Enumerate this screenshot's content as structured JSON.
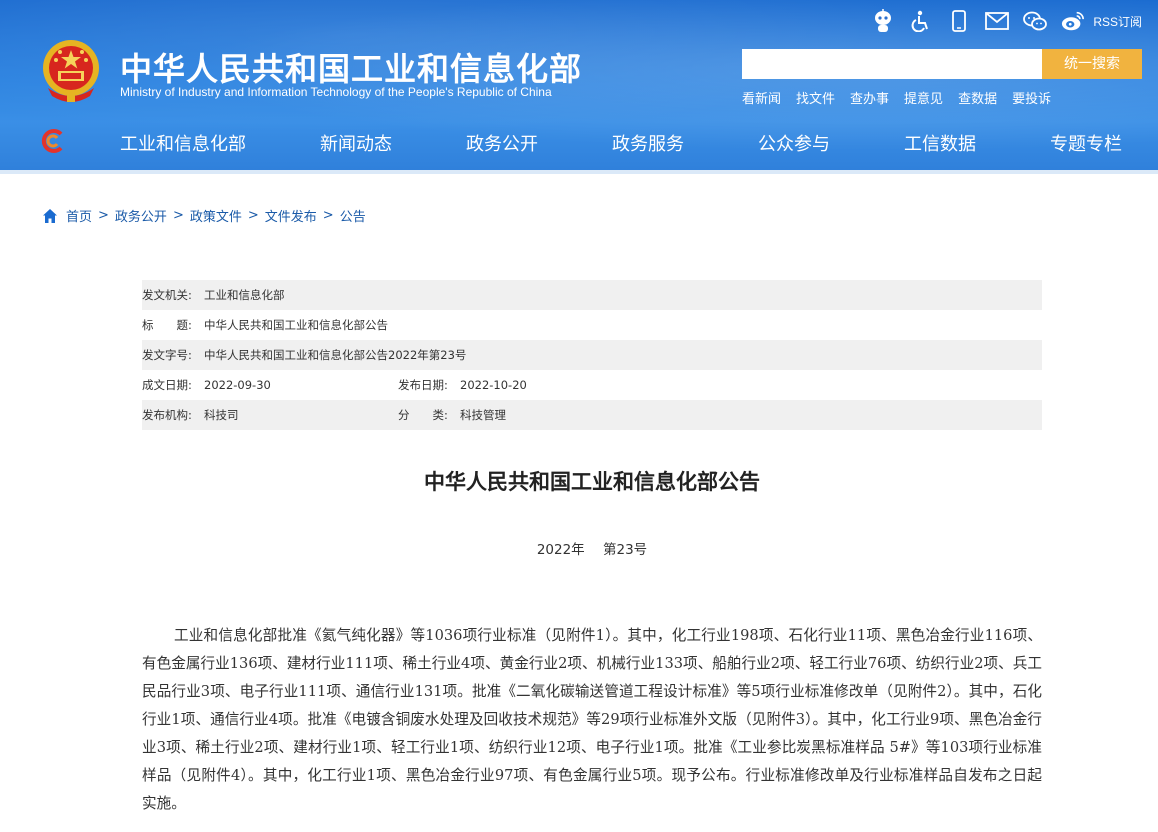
{
  "header": {
    "title": "中华人民共和国工业和信息化部",
    "subtitle": "Ministry of Industry and Information Technology of the People's Republic of China",
    "top_icons": [
      "robot-icon",
      "accessibility-icon",
      "mobile-icon",
      "mail-icon",
      "wechat-icon",
      "weibo-icon"
    ],
    "rss_label": "RSS订阅",
    "search": {
      "placeholder": "",
      "button_label": "统一搜索"
    },
    "quick_links": [
      "看新闻",
      "找文件",
      "查办事",
      "提意见",
      "查数据",
      "要投诉"
    ]
  },
  "nav": {
    "items": [
      "工业和信息化部",
      "新闻动态",
      "政务公开",
      "政务服务",
      "公众参与",
      "工信数据",
      "专题专栏"
    ]
  },
  "breadcrumb": {
    "items": [
      "首页",
      "政务公开",
      "政策文件",
      "文件发布",
      "公告"
    ],
    "separator": ">"
  },
  "meta": {
    "issuer_label": "发文机关:",
    "issuer": "工业和信息化部",
    "title_label": "标　　题:",
    "title": "中华人民共和国工业和信息化部公告",
    "doc_no_label": "发文字号:",
    "doc_no": "中华人民共和国工业和信息化部公告2022年第23号",
    "created_label": "成文日期:",
    "created": "2022-09-30",
    "published_label": "发布日期:",
    "published": "2022-10-20",
    "org_label": "发布机构:",
    "org": "科技司",
    "category_label": "分　　类:",
    "category": "科技管理"
  },
  "article": {
    "title": "中华人民共和国工业和信息化部公告",
    "number": "2022年 第23号",
    "body": "工业和信息化部批准《氦气纯化器》等1036项行业标准（见附件1）。其中，化工行业198项、石化行业11项、黑色冶金行业116项、有色金属行业136项、建材行业111项、稀土行业4项、黄金行业2项、机械行业133项、船舶行业2项、轻工行业76项、纺织行业2项、兵工民品行业3项、电子行业111项、通信行业131项。批准《二氧化碳输送管道工程设计标准》等5项行业标准修改单（见附件2）。其中，石化行业1项、通信行业4项。批准《电镀含铜废水处理及回收技术规范》等29项行业标准外文版（见附件3）。其中，化工行业9项、黑色冶金行业3项、稀土行业2项、建材行业1项、轻工行业1项、纺织行业12项、电子行业1项。批准《工业参比炭黑标准样品 5#》等103项行业标准样品（见附件4）。其中，化工行业1项、黑色冶金行业97项、有色金属行业5项。现予公布。行业标准修改单及行业标准样品自发布之日起实施。"
  },
  "colors": {
    "header_blue": "#2b82e0",
    "search_button": "#f1b33f",
    "link_blue": "#1a5aa8",
    "meta_shade": "#f0f0f0"
  }
}
